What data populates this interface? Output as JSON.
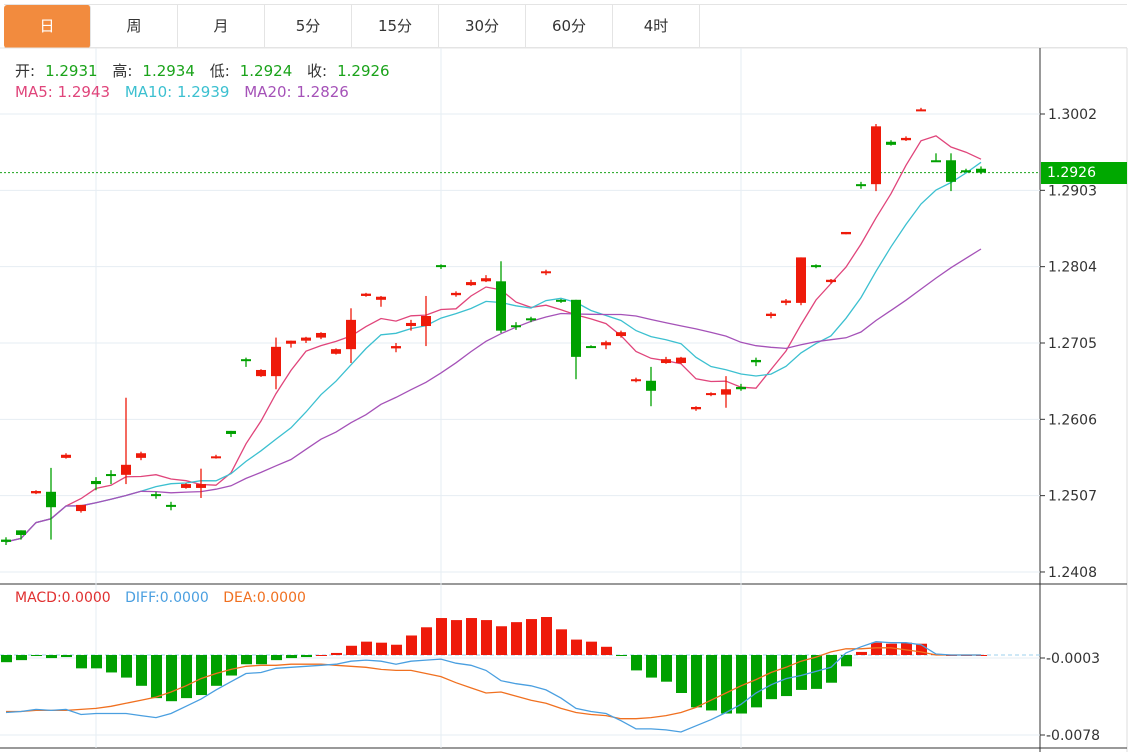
{
  "tabs": [
    "日",
    "周",
    "月",
    "5分",
    "15分",
    "30分",
    "60分",
    "4时"
  ],
  "active_tab": 0,
  "ohlc_legend": {
    "open_label": "开:",
    "open": "1.2931",
    "high_label": "高:",
    "high": "1.2934",
    "low_label": "低:",
    "low": "1.2924",
    "close_label": "收:",
    "close": "1.2926"
  },
  "ma_legend": {
    "ma5": "MA5: 1.2943",
    "ma10": "MA10: 1.2939",
    "ma20": "MA20: 1.2826"
  },
  "macd_legend": {
    "macd": "MACD:0.0000",
    "diff": "DIFF:0.0000",
    "dea": "DEA:0.0000"
  },
  "current_price": "1.2926",
  "colors": {
    "up": "#ee1a0a",
    "down": "#00a000",
    "ma5": "#e0457b",
    "ma10": "#3cc0d0",
    "ma20": "#a552b8",
    "diff": "#4a9fe0",
    "dea": "#f07020",
    "active_tab": "#f28b3e"
  },
  "chart_data": [
    {
      "type": "candlestick",
      "title": "K-line",
      "y_ticks": [
        "1.3002",
        "1.2903",
        "1.2804",
        "1.2705",
        "1.2606",
        "1.2507",
        "1.2408"
      ],
      "ylim": [
        1.2396,
        1.305
      ],
      "candles": [
        [
          1.245,
          1.2447,
          1.2453,
          1.2443
        ],
        [
          1.2462,
          1.2456,
          1.2462,
          1.245
        ],
        [
          1.251,
          1.2513,
          1.2514,
          1.2509
        ],
        [
          1.2512,
          1.2492,
          1.2543,
          1.245
        ],
        [
          1.2556,
          1.256,
          1.2562,
          1.2555
        ],
        [
          1.2487,
          1.2495,
          1.2495,
          1.2485
        ],
        [
          1.2526,
          1.2522,
          1.2531,
          1.2514
        ],
        [
          1.2535,
          1.2533,
          1.254,
          1.2522
        ],
        [
          1.2534,
          1.2547,
          1.2634,
          1.2522
        ],
        [
          1.2556,
          1.2562,
          1.2564,
          1.2553
        ],
        [
          1.2509,
          1.2507,
          1.2512,
          1.2503
        ],
        [
          1.2495,
          1.2494,
          1.2499,
          1.2488
        ],
        [
          1.2517,
          1.2522,
          1.2523,
          1.2516
        ],
        [
          1.2517,
          1.2522,
          1.2542,
          1.2504
        ],
        [
          1.2556,
          1.2558,
          1.256,
          1.2555
        ],
        [
          1.2591,
          1.2587,
          1.2591,
          1.2583
        ],
        [
          1.2684,
          1.2682,
          1.2686,
          1.2674
        ],
        [
          1.2662,
          1.267,
          1.2671,
          1.2661
        ],
        [
          1.2662,
          1.27,
          1.2712,
          1.2645
        ],
        [
          1.2704,
          1.2708,
          1.2708,
          1.2699
        ],
        [
          1.2708,
          1.2712,
          1.2713,
          1.2705
        ],
        [
          1.2712,
          1.2718,
          1.2719,
          1.271
        ],
        [
          1.2691,
          1.2697,
          1.2698,
          1.269
        ],
        [
          1.2697,
          1.2735,
          1.275,
          1.2679
        ],
        [
          1.2766,
          1.2769,
          1.277,
          1.2765
        ],
        [
          1.2761,
          1.2765,
          1.2766,
          1.2752
        ],
        [
          1.2698,
          1.2701,
          1.2705,
          1.2693
        ],
        [
          1.2727,
          1.2731,
          1.2735,
          1.2721
        ],
        [
          1.2727,
          1.274,
          1.2766,
          1.2701
        ],
        [
          1.2806,
          1.2805,
          1.2807,
          1.2801
        ],
        [
          1.2767,
          1.277,
          1.2772,
          1.2765
        ],
        [
          1.278,
          1.2784,
          1.2787,
          1.2779
        ],
        [
          1.2785,
          1.2789,
          1.2793,
          1.2784
        ],
        [
          1.2785,
          1.2721,
          1.2811,
          1.2718
        ],
        [
          1.2728,
          1.2726,
          1.2732,
          1.2722
        ],
        [
          1.2737,
          1.2736,
          1.2739,
          1.2732
        ],
        [
          1.2796,
          1.2798,
          1.28,
          1.2793
        ],
        [
          1.2761,
          1.276,
          1.2762,
          1.2757
        ],
        [
          1.2761,
          1.2687,
          1.2761,
          1.2658
        ],
        [
          1.2701,
          1.27,
          1.2702,
          1.2699
        ],
        [
          1.2702,
          1.2706,
          1.2708,
          1.2697
        ],
        [
          1.2714,
          1.2719,
          1.2721,
          1.2712
        ],
        [
          1.2656,
          1.2658,
          1.266,
          1.2654
        ],
        [
          1.2656,
          1.2643,
          1.2674,
          1.2623
        ],
        [
          1.2679,
          1.2684,
          1.2687,
          1.2678
        ],
        [
          1.2679,
          1.2686,
          1.2687,
          1.2678
        ],
        [
          1.2619,
          1.2622,
          1.2623,
          1.2617
        ],
        [
          1.2638,
          1.264,
          1.2641,
          1.2636
        ],
        [
          1.2638,
          1.2645,
          1.2662,
          1.2621
        ],
        [
          1.2648,
          1.2645,
          1.2652,
          1.2643
        ],
        [
          1.2683,
          1.268,
          1.2686,
          1.2675
        ],
        [
          1.274,
          1.2743,
          1.2745,
          1.2737
        ],
        [
          1.2757,
          1.276,
          1.2762,
          1.2754
        ],
        [
          1.2757,
          1.2816,
          1.2816,
          1.2754
        ],
        [
          1.2806,
          1.2805,
          1.2807,
          1.2802
        ],
        [
          1.2784,
          1.2787,
          1.2788,
          1.2782
        ],
        [
          1.2846,
          1.2849,
          1.2849,
          1.2846
        ],
        [
          1.2911,
          1.2909,
          1.2914,
          1.2905
        ],
        [
          1.2911,
          1.2986,
          1.2989,
          1.2902
        ],
        [
          1.2966,
          1.2962,
          1.2968,
          1.2961
        ],
        [
          1.2968,
          1.2971,
          1.2973,
          1.2967
        ],
        [
          1.3006,
          1.3008,
          1.301,
          1.3006
        ],
        [
          1.2942,
          1.2941,
          1.2951,
          1.2941
        ],
        [
          1.2942,
          1.2914,
          1.2951,
          1.2902
        ],
        [
          1.2929,
          1.2928,
          1.2931,
          1.2927
        ],
        [
          1.2931,
          1.2926,
          1.2934,
          1.2924
        ]
      ],
      "candle_fields": [
        "open",
        "close",
        "high",
        "low"
      ],
      "ma_periods": [
        5,
        10,
        20
      ]
    },
    {
      "type": "bar+line",
      "title": "MACD",
      "y_ticks": [
        "-0.0003",
        "-0.0078"
      ],
      "macd": [
        -0.0007,
        -0.0005,
        -0.0001,
        -0.0003,
        -0.0002,
        -0.0013,
        -0.0013,
        -0.0017,
        -0.0022,
        -0.003,
        -0.0042,
        -0.0045,
        -0.0042,
        -0.0039,
        -0.003,
        -0.002,
        -0.0009,
        -0.0009,
        -0.0005,
        -0.0003,
        -0.0002,
        0.0,
        0.0002,
        0.0009,
        0.0013,
        0.0012,
        0.001,
        0.0019,
        0.0027,
        0.0036,
        0.0034,
        0.0036,
        0.0034,
        0.0028,
        0.0032,
        0.0035,
        0.0037,
        0.0025,
        0.0015,
        0.0013,
        0.0008,
        -0.0001,
        -0.0015,
        -0.0022,
        -0.0026,
        -0.0037,
        -0.0051,
        -0.0054,
        -0.0057,
        -0.0057,
        -0.0051,
        -0.0043,
        -0.004,
        -0.0034,
        -0.0033,
        -0.0027,
        -0.0011,
        0.0003,
        0.0012,
        0.0011,
        0.0012,
        0.0011,
        0.0001,
        0.0,
        0.0,
        0.0
      ],
      "diff": [
        -0.0056,
        -0.0055,
        -0.0053,
        -0.0054,
        -0.0053,
        -0.0058,
        -0.0057,
        -0.0057,
        -0.0057,
        -0.0059,
        -0.0061,
        -0.0057,
        -0.005,
        -0.0043,
        -0.0034,
        -0.0026,
        -0.0018,
        -0.0017,
        -0.0013,
        -0.0012,
        -0.0011,
        -0.001,
        -0.0009,
        -0.0006,
        -0.0005,
        -0.0006,
        -0.0009,
        -0.0006,
        -0.0005,
        -0.0004,
        -0.0008,
        -0.001,
        -0.0015,
        -0.0025,
        -0.0028,
        -0.003,
        -0.0034,
        -0.0042,
        -0.0052,
        -0.0055,
        -0.0057,
        -0.0064,
        -0.0072,
        -0.0072,
        -0.0073,
        -0.0075,
        -0.0069,
        -0.0063,
        -0.0056,
        -0.0048,
        -0.0037,
        -0.0029,
        -0.0023,
        -0.002,
        -0.0016,
        -0.0012,
        0.0002,
        0.0008,
        0.0013,
        0.0012,
        0.0012,
        0.001,
        0.0001,
        0.0,
        0.0,
        0.0
      ],
      "dea": [
        -0.0055,
        -0.0055,
        -0.0054,
        -0.0054,
        -0.0054,
        -0.0053,
        -0.0052,
        -0.005,
        -0.0047,
        -0.0044,
        -0.0041,
        -0.0036,
        -0.003,
        -0.0023,
        -0.0018,
        -0.0014,
        -0.0011,
        -0.001,
        -0.001,
        -0.0009,
        -0.0009,
        -0.0009,
        -0.001,
        -0.0011,
        -0.0012,
        -0.0014,
        -0.0015,
        -0.0015,
        -0.0018,
        -0.0021,
        -0.0027,
        -0.0032,
        -0.0037,
        -0.0036,
        -0.004,
        -0.0044,
        -0.0047,
        -0.0052,
        -0.0056,
        -0.0058,
        -0.0059,
        -0.0062,
        -0.0062,
        -0.0061,
        -0.0059,
        -0.0056,
        -0.0051,
        -0.0044,
        -0.0037,
        -0.003,
        -0.0024,
        -0.0017,
        -0.0012,
        -0.0006,
        -0.0002,
        0.0003,
        0.0006,
        0.0006,
        0.0007,
        0.0007,
        0.0005,
        0.0003,
        0.0,
        0.0,
        0.0,
        0.0
      ]
    }
  ]
}
